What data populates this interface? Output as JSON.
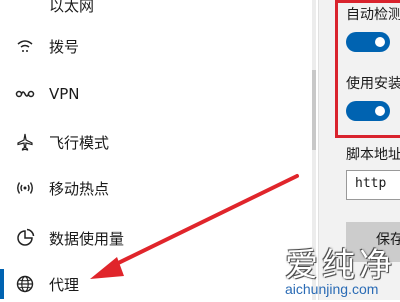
{
  "sidebar": {
    "items": [
      {
        "label": "以太网",
        "icon": "ethernet-icon"
      },
      {
        "label": "拨号",
        "icon": "dial-up-icon"
      },
      {
        "label": "VPN",
        "icon": "vpn-icon"
      },
      {
        "label": "飞行模式",
        "icon": "airplane-icon"
      },
      {
        "label": "移动热点",
        "icon": "hotspot-icon"
      },
      {
        "label": "数据使用量",
        "icon": "data-usage-icon"
      },
      {
        "label": "代理",
        "icon": "globe-icon",
        "active": true
      }
    ]
  },
  "panel": {
    "auto_detect_label": "自动检测",
    "auto_detect_on": true,
    "use_script_label": "使用安装",
    "use_script_on": true,
    "script_address_label": "脚本地址",
    "script_address_value": "http",
    "save_label": "保存"
  },
  "watermark": {
    "brand": "爱纯净",
    "url": "aichunjing.com"
  },
  "colors": {
    "accent": "#0063b1",
    "highlight": "#d9232d",
    "arrow": "#e0252b"
  }
}
